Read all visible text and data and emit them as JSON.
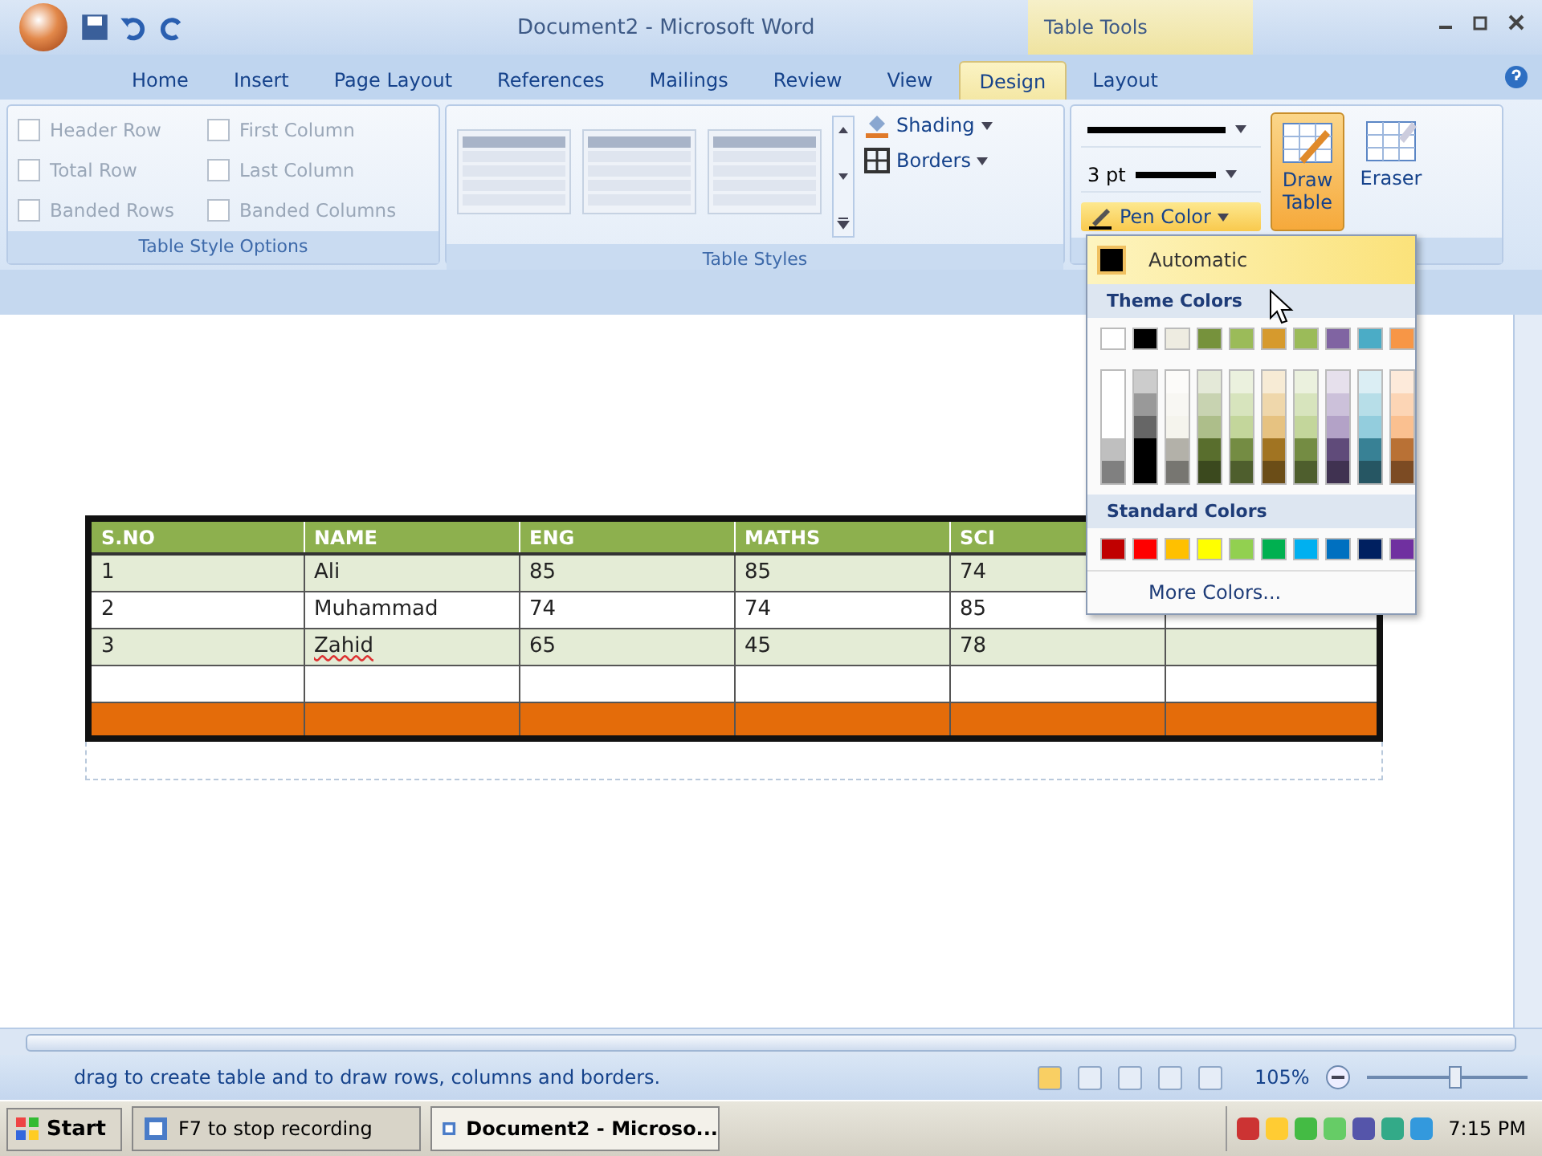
{
  "window": {
    "title": "Document2 - Microsoft Word",
    "context_title": "Table Tools"
  },
  "tabs": [
    {
      "label": "Home",
      "selected": false
    },
    {
      "label": "Insert",
      "selected": false
    },
    {
      "label": "Page Layout",
      "selected": false
    },
    {
      "label": "References",
      "selected": false
    },
    {
      "label": "Mailings",
      "selected": false
    },
    {
      "label": "Review",
      "selected": false
    },
    {
      "label": "View",
      "selected": false
    },
    {
      "label": "Design",
      "selected": true
    },
    {
      "label": "Layout",
      "selected": false
    }
  ],
  "style_options": {
    "label": "Table Style Options",
    "items": [
      {
        "label": "Header Row",
        "checked": false
      },
      {
        "label": "First Column",
        "checked": false
      },
      {
        "label": "Total Row",
        "checked": false
      },
      {
        "label": "Last Column",
        "checked": false
      },
      {
        "label": "Banded Rows",
        "checked": false
      },
      {
        "label": "Banded Columns",
        "checked": false
      }
    ]
  },
  "table_styles": {
    "label": "Table Styles",
    "shading": "Shading",
    "borders": "Borders"
  },
  "draw_borders": {
    "weight": "3 pt",
    "pen_color": "Pen Color",
    "draw_table": {
      "label": "Draw Table",
      "selected": true
    },
    "eraser": {
      "label": "Eraser",
      "selected": false
    }
  },
  "pen_menu": {
    "automatic": "Automatic",
    "theme_header": "Theme Colors",
    "theme_colors": [
      {
        "color": "#ffffff"
      },
      {
        "color": "#000000"
      },
      {
        "color": "#eeece1"
      },
      {
        "color": "#76923c"
      },
      {
        "color": "#9bbb59"
      },
      {
        "color": "#d69a2d"
      },
      {
        "color": "#9bbb59"
      },
      {
        "color": "#8064a2"
      },
      {
        "color": "#4bacc6"
      },
      {
        "color": "#f79646"
      }
    ],
    "standard_header": "Standard Colors",
    "standard_colors": [
      {
        "color": "#c00000"
      },
      {
        "color": "#ff0000"
      },
      {
        "color": "#ffc000"
      },
      {
        "color": "#ffff00"
      },
      {
        "color": "#92d050"
      },
      {
        "color": "#00b050"
      },
      {
        "color": "#00b0f0"
      },
      {
        "color": "#0070c0"
      },
      {
        "color": "#002060"
      },
      {
        "color": "#7030a0"
      }
    ],
    "more": "More Colors..."
  },
  "table": {
    "columns": [
      "S.NO",
      "NAME",
      "ENG",
      "MATHS",
      "SCI"
    ],
    "rows": [
      {
        "kind": "data",
        "cells": [
          {
            "text": "1"
          },
          {
            "text": "Ali"
          },
          {
            "text": "85"
          },
          {
            "text": "85"
          },
          {
            "text": "74"
          }
        ]
      },
      {
        "kind": "data",
        "cells": [
          {
            "text": "2"
          },
          {
            "text": "Muhammad"
          },
          {
            "text": "74"
          },
          {
            "text": "74"
          },
          {
            "text": "85"
          }
        ]
      },
      {
        "kind": "data",
        "cells": [
          {
            "text": "3"
          },
          {
            "text": "Zahid",
            "misspelled": true
          },
          {
            "text": "65"
          },
          {
            "text": "45"
          },
          {
            "text": "78"
          }
        ]
      },
      {
        "kind": "empty"
      },
      {
        "kind": "accent"
      }
    ]
  },
  "status_bar": {
    "text": "drag to create table and to draw rows, columns and borders.",
    "views": [
      {
        "selected": true
      },
      {
        "selected": false
      },
      {
        "selected": false
      },
      {
        "selected": false
      },
      {
        "selected": false
      }
    ],
    "zoom": "105%",
    "zoom_slider": {
      "level": 0.55
    }
  },
  "taskbar": {
    "start": "Start",
    "tasks": [
      {
        "label": "F7 to stop recording",
        "selected": false
      },
      {
        "label": "Document2 - Microso...",
        "selected": true
      }
    ],
    "clock": "7:15 PM"
  }
}
